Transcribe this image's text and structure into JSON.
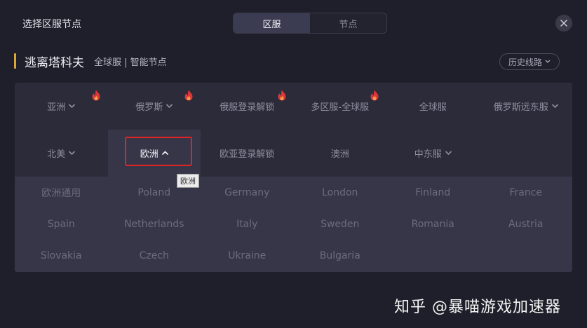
{
  "header": {
    "title": "选择区服节点",
    "tabs": [
      {
        "label": "区服",
        "active": true
      },
      {
        "label": "节点",
        "active": false
      }
    ]
  },
  "game": {
    "name": "逃离塔科夫",
    "subtitle": "全球服 | 智能节点",
    "history_label": "历史线路"
  },
  "regions_row1": [
    {
      "label": "亚洲",
      "dropdown": true,
      "hot": true
    },
    {
      "label": "俄罗斯",
      "dropdown": true,
      "hot": true
    },
    {
      "label": "俄服登录解锁",
      "dropdown": false,
      "hot": true
    },
    {
      "label": "多区服-全球服",
      "dropdown": false,
      "hot": true
    },
    {
      "label": "全球服",
      "dropdown": false,
      "hot": false
    },
    {
      "label": "俄罗斯远东服",
      "dropdown": true,
      "hot": false
    }
  ],
  "regions_row2": [
    {
      "label": "北美",
      "dropdown": true,
      "hot": false
    },
    {
      "label": "欧洲",
      "dropdown": true,
      "hot": false,
      "selected": true
    },
    {
      "label": "欧亚登录解锁",
      "dropdown": false,
      "hot": false
    },
    {
      "label": "澳洲",
      "dropdown": false,
      "hot": false
    },
    {
      "label": "中东服",
      "dropdown": true,
      "hot": false
    }
  ],
  "tooltip": "欧洲",
  "nodes": [
    [
      "欧洲通用",
      "Poland",
      "Germany",
      "London",
      "Finland",
      "France"
    ],
    [
      "Spain",
      "Netherlands",
      "Italy",
      "Sweden",
      "Romania",
      "Austria"
    ],
    [
      "Slovakia",
      "Czech",
      "Ukraine",
      "Bulgaria"
    ]
  ],
  "watermark": "知乎 @暴喵游戏加速器",
  "colors": {
    "background": "#1f1f2b",
    "panel": "#2b2b39",
    "selected": "#363648",
    "accent": "#d9a736",
    "fire": "#d9383a",
    "highlight": "#e02323"
  }
}
